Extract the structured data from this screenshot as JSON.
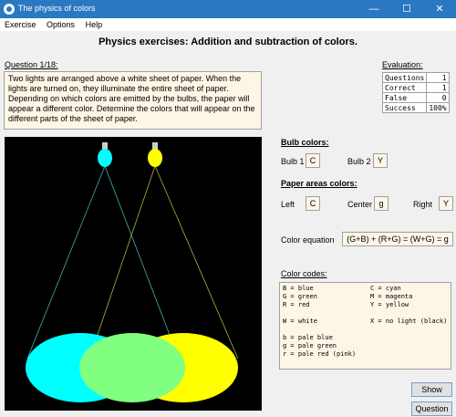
{
  "window": {
    "title": "The physics of colors",
    "minimize": "—",
    "maximize": "☐",
    "close": "✕"
  },
  "menu": [
    "Exercise",
    "Options",
    "Help"
  ],
  "heading": "Physics exercises: Addition and subtraction of colors.",
  "question": {
    "label": "Question 1/18:",
    "text": "Two  lights are arranged above a white  sheet of paper.  When the lights are turned on,  they illuminate the entire sheet of paper.  Depending on which colors are emitted by the bulbs,  the paper will appear a different color.  Determine the colors that will appear on the different parts of the sheet of paper."
  },
  "evaluation": {
    "label": "Evaluation:",
    "rows": [
      {
        "name": "Questions",
        "value": "1"
      },
      {
        "name": "Correct",
        "value": "1"
      },
      {
        "name": "False",
        "value": "0"
      },
      {
        "name": "Success",
        "value": "100%"
      }
    ]
  },
  "scene": {
    "colors": {
      "background": "#000000",
      "cyan": "#00ffff",
      "yellow": "#ffff00",
      "green": "#80ff80",
      "ray_cyan": "#40b0b0",
      "ray_yellow": "#b0b040"
    }
  },
  "bulb_colors": {
    "label": "Bulb colors:",
    "bulb1_label": "Bulb 1",
    "bulb1_value": "C",
    "bulb2_label": "Bulb 2",
    "bulb2_value": "Y"
  },
  "paper_areas": {
    "label": "Paper areas colors:",
    "left_label": "Left",
    "left_value": "C",
    "center_label": "Center",
    "center_value": "g",
    "right_label": "Right",
    "right_value": "Y"
  },
  "equation": {
    "label": "Color equation",
    "value": "(G+B) + (R+G) = (W+G) = g"
  },
  "color_codes": {
    "label": "Color codes:",
    "rows": [
      [
        "B = blue",
        "C = cyan"
      ],
      [
        "G = green",
        "M = magenta"
      ],
      [
        "R = red",
        "Y = yellow"
      ],
      [
        "",
        ""
      ],
      [
        "W = white",
        "X = no light (black)"
      ],
      [
        "",
        ""
      ],
      [
        "b = pale blue",
        ""
      ],
      [
        "g = pale green",
        ""
      ],
      [
        "r = pale red (pink)",
        ""
      ]
    ]
  },
  "buttons": {
    "show": "Show",
    "question": "Question"
  }
}
